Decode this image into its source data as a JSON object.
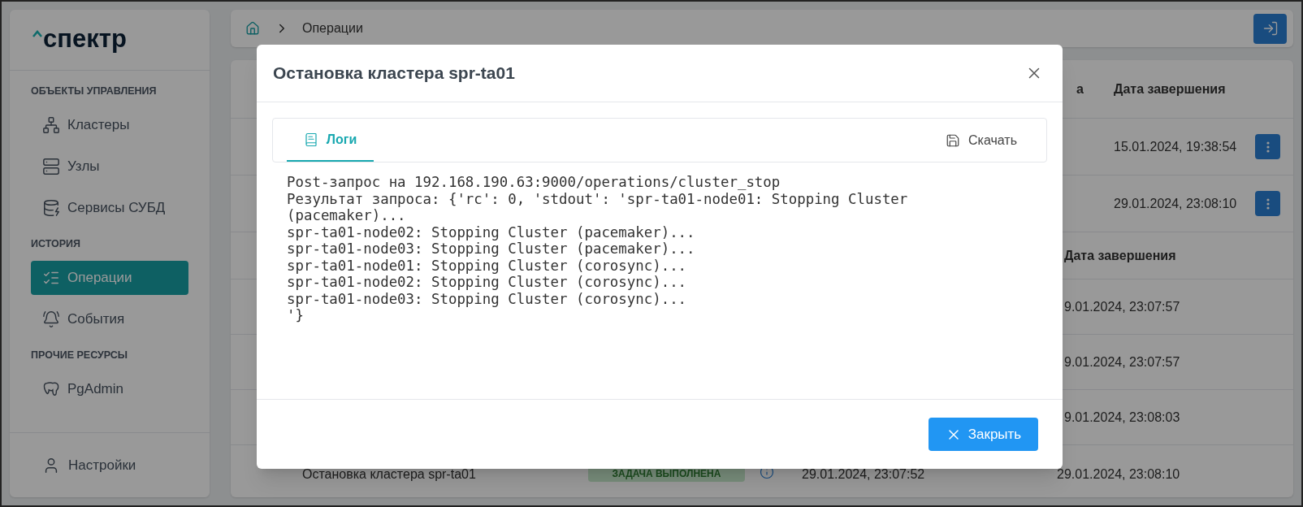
{
  "sidebar": {
    "logo": "спектр",
    "sections": [
      {
        "title": "ОБЪЕКТЫ УПРАВЛЕНИЯ",
        "items": [
          {
            "label": "Кластеры",
            "selected": false
          },
          {
            "label": "Узлы",
            "selected": false
          },
          {
            "label": "Сервисы СУБД",
            "selected": false
          }
        ]
      },
      {
        "title": "ИСТОРИЯ",
        "items": [
          {
            "label": "Операции",
            "selected": true
          },
          {
            "label": "События",
            "selected": false
          }
        ]
      },
      {
        "title": "ПРОЧИЕ РЕСУРСЫ",
        "items": [
          {
            "label": "PgAdmin",
            "selected": false
          }
        ]
      }
    ],
    "footer_item": {
      "label": "Настройки"
    }
  },
  "breadcrumb": [
    "Операции"
  ],
  "table": {
    "columns": [
      "а",
      "Дата завершения"
    ],
    "rows": [
      {
        "end": "15.01.2024, 19:38:54"
      },
      {
        "end": "29.01.2024, 23:08:10"
      }
    ],
    "nested": {
      "columns": [
        "Дата завершения"
      ],
      "rows": [
        {
          "end": "9.01.2024, 23:07:57"
        },
        {
          "end": "9.01.2024, 23:07:57"
        },
        {
          "end": "9.01.2024, 23:08:03"
        }
      ],
      "last_row": {
        "name": "Остановка кластера spr-ta01",
        "status": "ЗАДАЧА ВЫПОЛНЕНА",
        "start": "29.01.2024, 23:07:52",
        "end": "29.01.2024, 23:08:10"
      }
    }
  },
  "modal": {
    "title": "Остановка кластера spr-ta01",
    "tabs": [
      {
        "label": "Логи",
        "selected": true
      }
    ],
    "download": "Скачать",
    "log_lines": [
      "Post-запрос на 192.168.190.63:9000/operations/cluster_stop",
      "Результат запроса: {'rc': 0, 'stdout': 'spr-ta01-node01: Stopping Cluster (pacemaker)...",
      "spr-ta01-node02: Stopping Cluster (pacemaker)...",
      "spr-ta01-node03: Stopping Cluster (pacemaker)...",
      "spr-ta01-node01: Stopping Cluster (corosync)...",
      "spr-ta01-node02: Stopping Cluster (corosync)...",
      "spr-ta01-node03: Stopping Cluster (corosync)...",
      "'}"
    ],
    "close_button": "Закрыть"
  }
}
